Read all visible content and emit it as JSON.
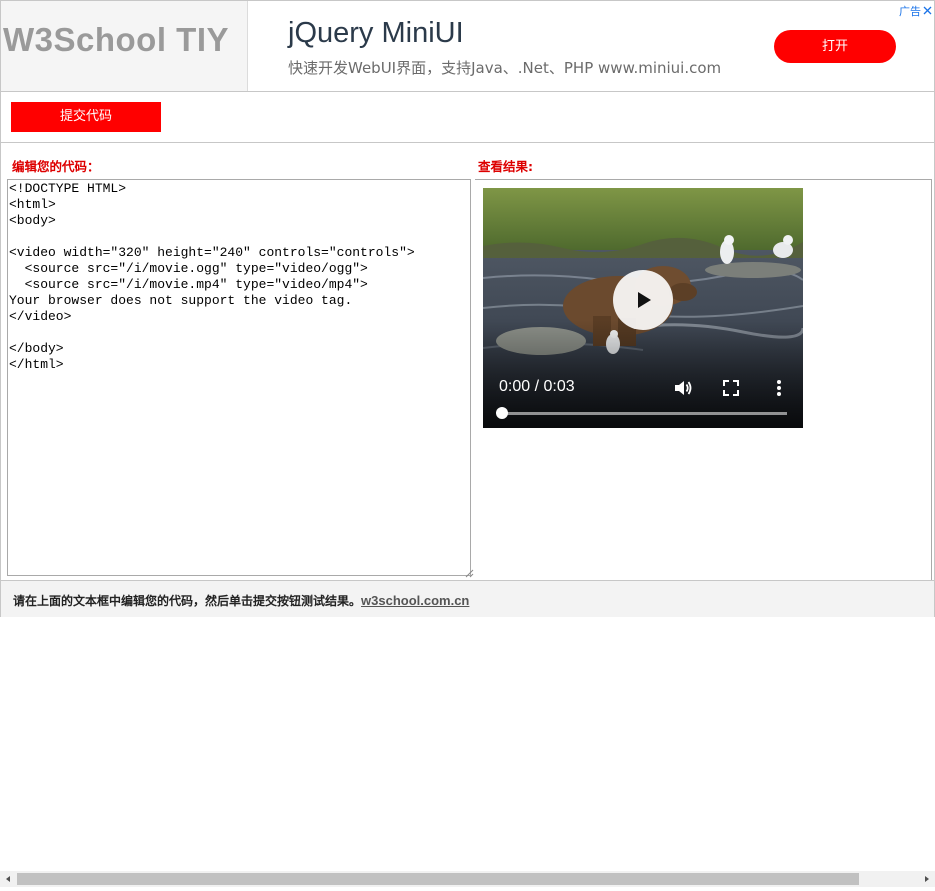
{
  "header": {
    "logo_text": "W3School TIY",
    "ad": {
      "title": "jQuery MiniUI",
      "subtitle": "快速开发WebUI界面，支持Java、.Net、PHP www.miniui.com",
      "open_button": "打开",
      "ad_tag": "广告",
      "button_color": "#ff0000"
    }
  },
  "toolbar": {
    "submit_label": "提交代码",
    "button_color": "#ff0000"
  },
  "editor": {
    "label": "编辑您的代码：",
    "code": "<!DOCTYPE HTML>\n<html>\n<body>\n\n<video width=\"320\" height=\"240\" controls=\"controls\">\n  <source src=\"/i/movie.ogg\" type=\"video/ogg\">\n  <source src=\"/i/movie.mp4\" type=\"video/mp4\">\nYour browser does not support the video tag.\n</video>\n\n</body>\n</html>"
  },
  "result": {
    "label": "查看结果:",
    "video": {
      "time": "0:00 / 0:03",
      "progress": 0
    }
  },
  "footer": {
    "text": "请在上面的文本框中编辑您的代码，然后单击提交按钮测试结果。",
    "link": "w3school.com.cn"
  },
  "colors": {
    "label_red": "#dd0000",
    "accent": "#ff0000"
  },
  "icons": {
    "play": "play-icon",
    "volume": "volume-icon",
    "fullscreen": "fullscreen-icon",
    "more": "more-vert-icon",
    "ad_close": "close-icon"
  }
}
